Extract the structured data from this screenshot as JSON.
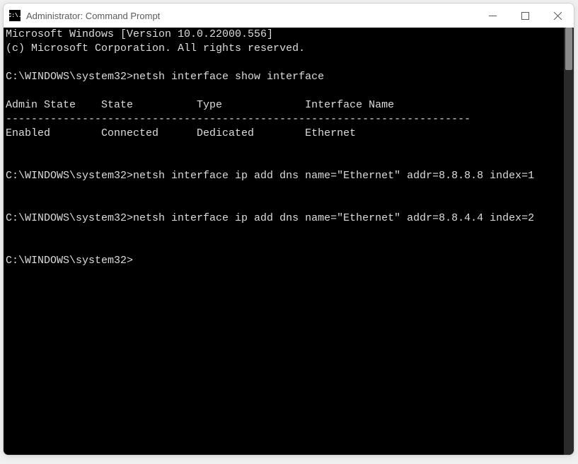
{
  "window": {
    "title": "Administrator: Command Prompt",
    "icon_label": "C:\\."
  },
  "terminal": {
    "header_line1": "Microsoft Windows [Version 10.0.22000.556]",
    "header_line2": "(c) Microsoft Corporation. All rights reserved.",
    "prompt": "C:\\WINDOWS\\system32>",
    "command1": "netsh interface show interface",
    "table_header": "Admin State    State          Type             Interface Name",
    "table_divider": "-------------------------------------------------------------------------",
    "table_row1": "Enabled        Connected      Dedicated        Ethernet",
    "command2": "netsh interface ip add dns name=\"Ethernet\" addr=8.8.8.8 index=1",
    "command3": "netsh interface ip add dns name=\"Ethernet\" addr=8.8.4.4 index=2"
  }
}
